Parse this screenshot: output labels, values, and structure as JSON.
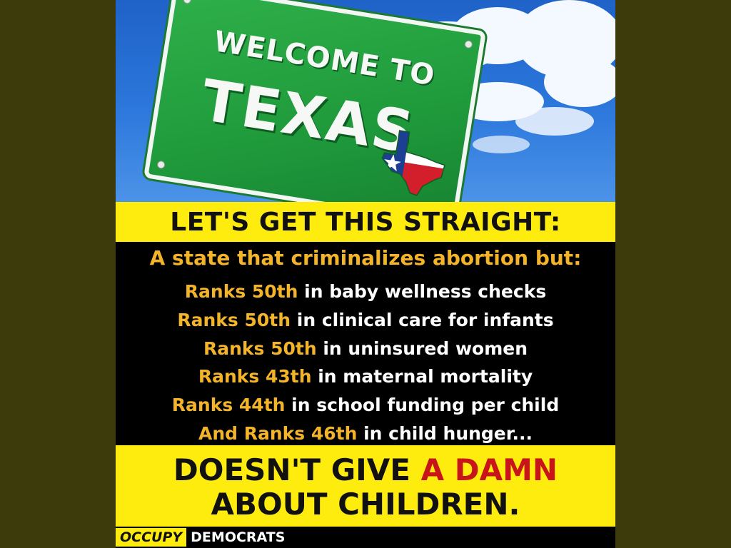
{
  "sign": {
    "line1": "WELCOME TO",
    "line2": "TEXAS"
  },
  "headline": "LET'S GET THIS STRAIGHT:",
  "intro": "A state that criminalizes abortion but:",
  "facts": [
    {
      "rank": "Ranks 50th",
      "text": " in baby wellness checks"
    },
    {
      "rank": "Ranks 50th",
      "text": " in clinical care for infants"
    },
    {
      "rank": "Ranks 50th",
      "text": " in uninsured women"
    },
    {
      "rank": "Ranks 43th",
      "text": " in maternal mortality"
    },
    {
      "rank": "Ranks 44th",
      "text": " in school funding per child"
    },
    {
      "rank": "And Ranks 46th",
      "text": " in child hunger..."
    }
  ],
  "conclusion": {
    "part1": "DOESN'T GIVE ",
    "highlight": "A DAMN",
    "line2": "ABOUT CHILDREN."
  },
  "logo": {
    "word1": "OCCUPY",
    "word2": "DEMOCRATS"
  },
  "colors": {
    "banner_yellow": "#ffec0f",
    "rank_orange": "#f3b42a",
    "highlight_red": "#c8151a",
    "sign_green": "#1f9a3b"
  }
}
